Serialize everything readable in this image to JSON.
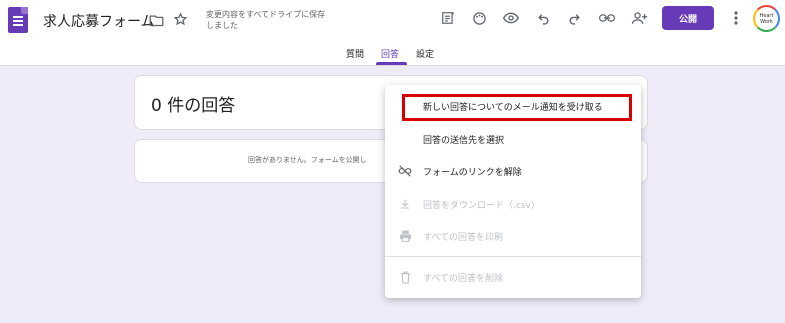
{
  "header": {
    "title": "求人応募フォーム",
    "save_status": "変更内容をすべてドライブに保存しました",
    "publish_label": "公開",
    "avatar_text": "Heart Work"
  },
  "tabs": [
    {
      "label": "質問"
    },
    {
      "label": "回答"
    },
    {
      "label": "設定"
    }
  ],
  "responses": {
    "count_label": "0 件の回答",
    "empty_message": "回答がありません。フォームを公開し"
  },
  "menu": {
    "items": [
      {
        "label": "新しい回答についてのメール通知を受け取る",
        "icon": "none"
      },
      {
        "label": "回答の送信先を選択",
        "icon": "none"
      },
      {
        "label": "フォームのリンクを解除",
        "icon": "link-off-icon"
      },
      {
        "label": "回答をダウンロード（.csv）",
        "icon": "download-icon"
      },
      {
        "label": "すべての回答を印刷",
        "icon": "print-icon"
      },
      {
        "label": "すべての回答を削除",
        "icon": "trash-icon"
      }
    ]
  },
  "colors": {
    "accent": "#673ab7",
    "background": "#f0ebf8",
    "highlight": "#d50000"
  }
}
